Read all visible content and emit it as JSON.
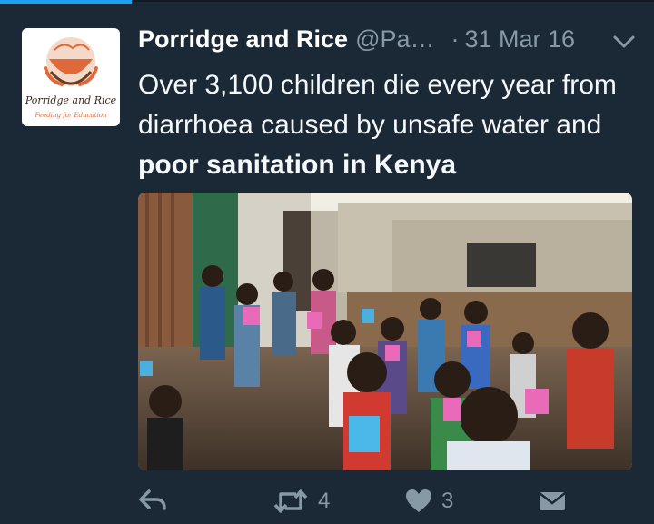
{
  "tweet": {
    "display_name": "Porridge and Rice",
    "handle": "@Pa…",
    "separator": "·",
    "timestamp": "31 Mar 16",
    "text_plain": "Over 3,100 children die every year from diarrhoea caused by unsafe water and ",
    "text_bold": "poor sanitation in Kenya",
    "media_alt": "Photo of children holding pink and blue cups in a Kenyan settlement"
  },
  "avatar": {
    "logo_name": "Porridge and Rice",
    "logo_tagline": "Feeding for Education",
    "colors": {
      "orange": "#e0693a",
      "brown": "#6b3b22"
    }
  },
  "actions": {
    "reply_icon": "reply-icon",
    "retweet_icon": "retweet-icon",
    "retweet_count": "4",
    "like_icon": "heart-icon",
    "like_count": "3",
    "dm_icon": "envelope-icon"
  },
  "theme": {
    "background": "#1b2836",
    "accent": "#1da1f2",
    "muted": "#8899a6"
  }
}
